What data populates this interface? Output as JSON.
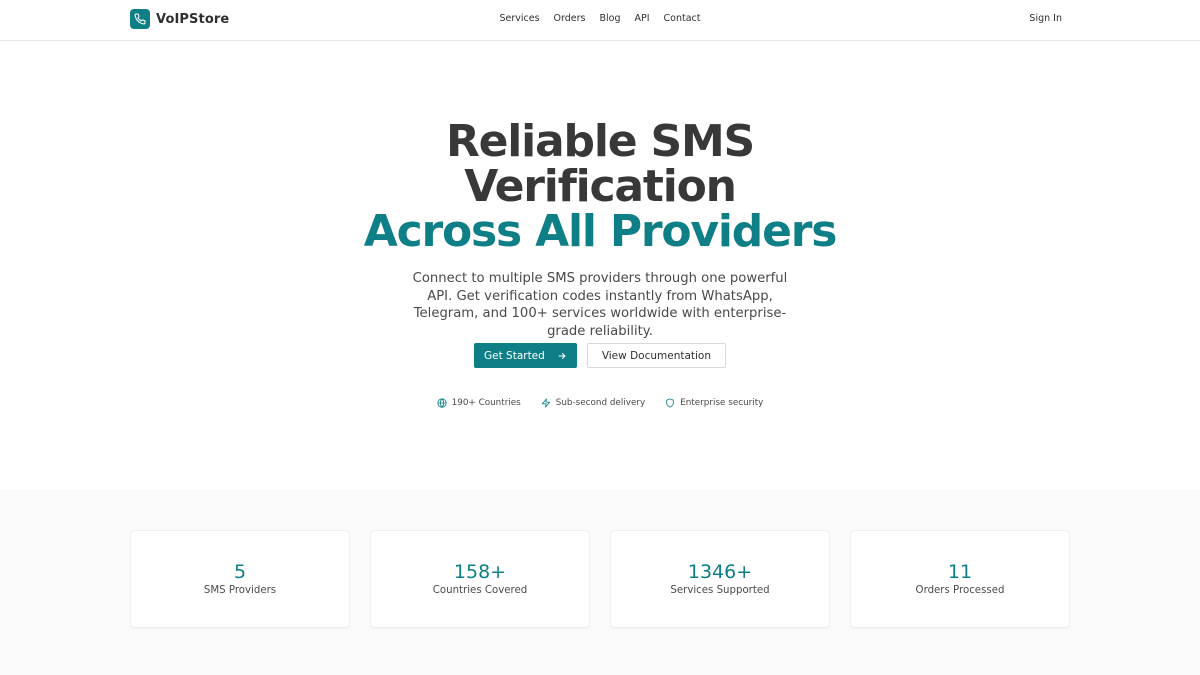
{
  "brand": {
    "name": "VoIPStore",
    "icon": "phone-icon",
    "color": "#0e7f86"
  },
  "nav": {
    "items": [
      {
        "label": "Services"
      },
      {
        "label": "Orders"
      },
      {
        "label": "Blog"
      },
      {
        "label": "API"
      },
      {
        "label": "Contact"
      }
    ],
    "sign_in": "Sign In"
  },
  "hero": {
    "title_line1": "Reliable SMS",
    "title_line2": "Verification",
    "title_accent": "Across All Providers",
    "subtitle": "Connect to multiple SMS providers through one powerful API. Get verification codes instantly from WhatsApp, Telegram, and 100+ services worldwide with enterprise-grade reliability.",
    "primary_button": "Get Started",
    "secondary_button": "View Documentation",
    "features": [
      {
        "icon": "globe-icon",
        "label": "190+ Countries"
      },
      {
        "icon": "lightning-icon",
        "label": "Sub-second delivery"
      },
      {
        "icon": "shield-icon",
        "label": "Enterprise security"
      }
    ]
  },
  "stats": [
    {
      "value": "5",
      "label": "SMS Providers"
    },
    {
      "value": "158+",
      "label": "Countries Covered"
    },
    {
      "value": "1346+",
      "label": "Services Supported"
    },
    {
      "value": "11",
      "label": "Orders Processed"
    }
  ]
}
